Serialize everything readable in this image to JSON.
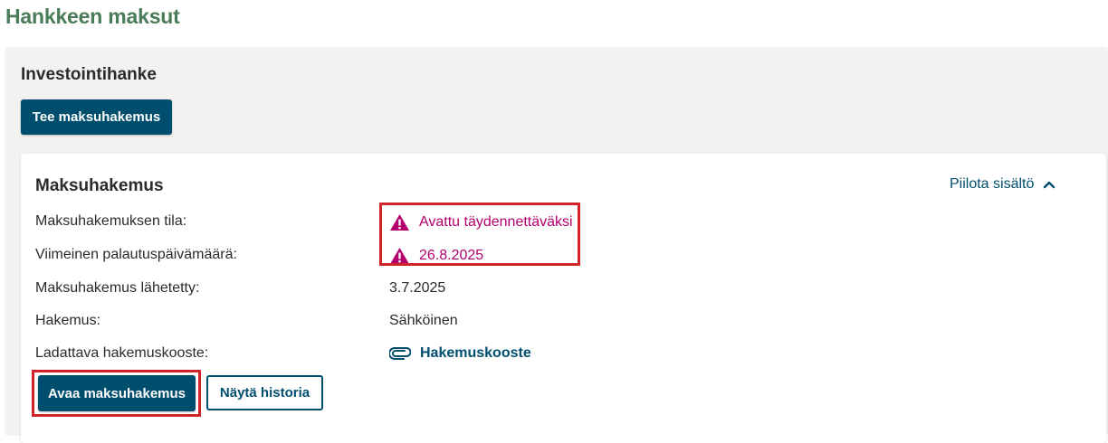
{
  "page": {
    "title": "Hankkeen maksut"
  },
  "project": {
    "title": "Investointihanke",
    "new_payment_button": "Tee maksuhakemus"
  },
  "card": {
    "title": "Maksuhakemus",
    "toggle_label": "Piilota sisältö",
    "rows": [
      {
        "label": "Maksuhakemuksen tila:",
        "value": "Avattu täydennettäväksi",
        "icon": "warning-icon"
      },
      {
        "label": "Viimeinen palautuspäivämäärä:",
        "value": "26.8.2025",
        "icon": "warning-icon"
      },
      {
        "label": "Maksuhakemus lähetetty:",
        "value": "3.7.2025"
      },
      {
        "label": "Hakemus:",
        "value": "Sähköinen"
      },
      {
        "label": "Ladattava hakemuskooste:",
        "value": "Hakemuskooste",
        "icon": "paperclip-icon"
      }
    ],
    "open_button": "Avaa maksuhakemus",
    "history_button": "Näytä historia"
  },
  "colors": {
    "title_green": "#4a7c59",
    "primary": "#004e6e",
    "warning": "#b4006e",
    "highlight": "#d2232a",
    "panel_bg": "#f3f2f1"
  }
}
